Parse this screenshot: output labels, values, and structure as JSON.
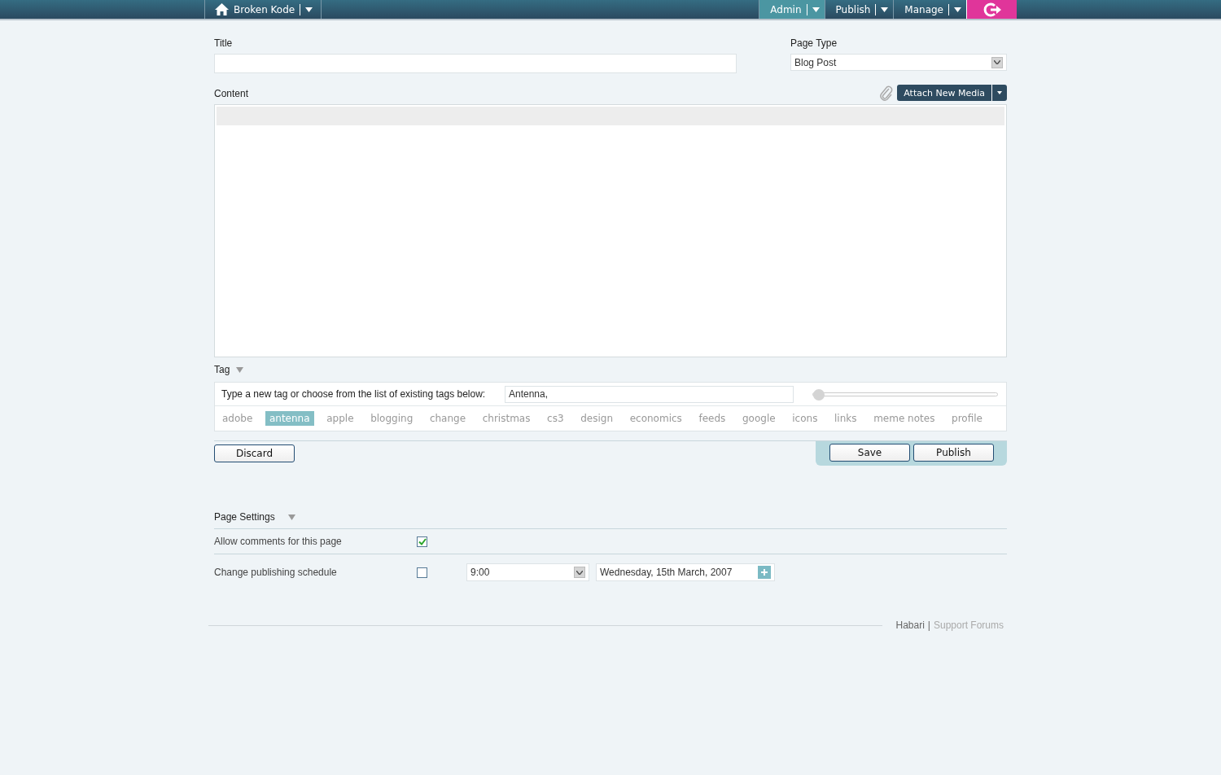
{
  "nav": {
    "site": "Broken Kode",
    "menus": [
      {
        "label": "Admin",
        "selected": true
      },
      {
        "label": "Publish",
        "selected": false
      },
      {
        "label": "Manage",
        "selected": false
      }
    ]
  },
  "title": {
    "label": "Title"
  },
  "page_type": {
    "label": "Page Type",
    "value": "Blog Post"
  },
  "content": {
    "label": "Content",
    "attach_button": "Attach New Media"
  },
  "tags": {
    "label": "Tag",
    "instruction": "Type a new tag or choose from the list of existing tags below:",
    "value": "Antenna,",
    "slider": {
      "level": 0
    },
    "items": [
      {
        "label": "adobe",
        "selected": false
      },
      {
        "label": "antenna",
        "selected": true
      },
      {
        "label": "apple",
        "selected": false
      },
      {
        "label": "blogging",
        "selected": false
      },
      {
        "label": "change",
        "selected": false
      },
      {
        "label": "christmas",
        "selected": false
      },
      {
        "label": "cs3",
        "selected": false
      },
      {
        "label": "design",
        "selected": false
      },
      {
        "label": "economics",
        "selected": false
      },
      {
        "label": "feeds",
        "selected": false
      },
      {
        "label": "google",
        "selected": false
      },
      {
        "label": "icons",
        "selected": false
      },
      {
        "label": "links",
        "selected": false
      },
      {
        "label": "meme notes",
        "selected": false
      },
      {
        "label": "profile",
        "selected": false
      }
    ]
  },
  "buttons": {
    "discard": "Discard",
    "save": "Save",
    "publish": "Publish"
  },
  "settings": {
    "label": "Page Settings",
    "rows": [
      {
        "label": "Allow comments for this page",
        "checked": true
      },
      {
        "label": "Change publishing schedule",
        "checked": false,
        "time": "9:00",
        "date": "Wednesday, 15th March, 2007"
      }
    ]
  },
  "footer": {
    "brand": "Habari",
    "separator": "|",
    "link": "Support Forums"
  }
}
